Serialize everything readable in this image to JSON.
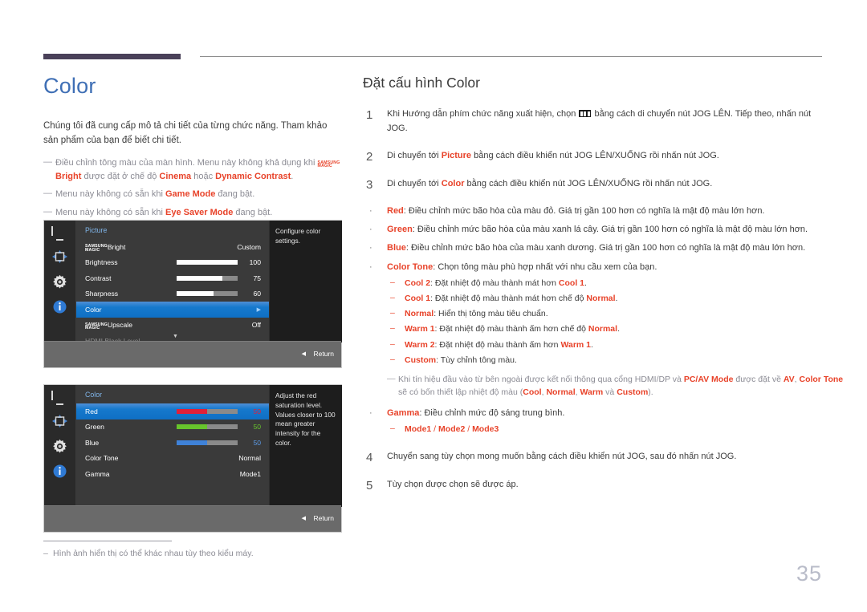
{
  "page_title": "Color",
  "page_number": "35",
  "left": {
    "intro": "Chúng tôi đã cung cấp mô tả chi tiết của từng chức năng. Tham khảo sản phẩm của bạn để biết chi tiết.",
    "note1_a": "Điều chỉnh tông màu của màn hình. Menu này không khả dụng khi ",
    "note1_magic_line1": "SAMSUNG",
    "note1_magic_line2": "MAGIC",
    "note1_b": "Bright",
    "note1_c": " được đặt ở chế độ ",
    "note1_d": "Cinema",
    "note1_e": " hoặc ",
    "note1_f": "Dynamic Contrast",
    "note1_g": ".",
    "note2_a": "Menu này không có sẵn khi ",
    "note2_b": "Game Mode",
    "note2_c": " đang bật.",
    "note3_a": "Menu này không có sẵn khi ",
    "note3_b": "Eye Saver Mode",
    "note3_c": " đang bật."
  },
  "footnote": {
    "text": "Hình ảnh hiển thị có thể khác nhau tùy theo kiểu máy."
  },
  "osd_picture": {
    "title": "Picture",
    "description": "Configure color settings.",
    "return_label": "Return",
    "rows": [
      {
        "label_magic1": "SAMSUNG",
        "label_magic2": "MAGIC",
        "label": "Bright",
        "value": "Custom",
        "slider": null,
        "state": "normal"
      },
      {
        "label": "Brightness",
        "value": "100",
        "slider": 100,
        "state": "normal"
      },
      {
        "label": "Contrast",
        "value": "75",
        "slider": 75,
        "state": "normal"
      },
      {
        "label": "Sharpness",
        "value": "60",
        "slider": 60,
        "state": "normal"
      },
      {
        "label": "Color",
        "value": "",
        "slider": null,
        "state": "selected"
      },
      {
        "label_magic1": "SAMSUNG",
        "label_magic2": "MAGIC",
        "label": "Upscale",
        "value": "Off",
        "slider": null,
        "state": "normal"
      },
      {
        "label": "HDMI Black Level",
        "value": "",
        "slider": null,
        "state": "dim"
      }
    ]
  },
  "osd_color": {
    "title": "Color",
    "description": "Adjust the red saturation level. Values closer to 100 mean greater intensity for the color.",
    "return_label": "Return",
    "rows": [
      {
        "label": "Red",
        "value": "50",
        "slider": 50,
        "state": "selected",
        "color": "#e0203a"
      },
      {
        "label": "Green",
        "value": "50",
        "slider": 50,
        "state": "normal",
        "color": "#67c42c"
      },
      {
        "label": "Blue",
        "value": "50",
        "slider": 50,
        "state": "normal",
        "color": "#3f82d8"
      },
      {
        "label": "Color Tone",
        "value": "Normal",
        "slider": null,
        "state": "normal"
      },
      {
        "label": "Gamma",
        "value": "Mode1",
        "slider": null,
        "state": "normal"
      }
    ]
  },
  "right": {
    "title": "Đặt cấu hình Color",
    "step1_num": "1",
    "step1_a": "Khi Hướng dẫn phím chức năng xuất hiện, chọn ",
    "step1_b": " bằng cách di chuyển nút JOG LÊN. Tiếp theo, nhấn nút JOG.",
    "step2_num": "2",
    "step2_a": "Di chuyển tới ",
    "step2_b": "Picture",
    "step2_c": " bằng cách điều khiển nút JOG LÊN/XUỐNG rồi nhấn nút JOG.",
    "step3_num": "3",
    "step3_a": "Di chuyển tới ",
    "step3_b": "Color",
    "step3_c": " bằng cách điều khiển nút JOG LÊN/XUỐNG rồi nhấn nút JOG.",
    "b_red_label": "Red",
    "b_red_text": ": Điều chỉnh mức bão hòa của màu đỏ. Giá trị gần 100 hơn có nghĩa là mật độ màu lớn hơn.",
    "b_green_label": "Green",
    "b_green_text": ": Điều chỉnh mức bão hòa của màu xanh lá cây. Giá trị gần 100 hơn có nghĩa là mật độ màu lớn hơn.",
    "b_blue_label": "Blue",
    "b_blue_text": ": Điều chỉnh mức bão hòa của màu xanh dương. Giá trị gần 100 hơn có nghĩa là mật độ màu lớn hơn.",
    "b_tone_label": "Color Tone",
    "b_tone_text": ": Chọn tông màu phù hợp nhất với nhu cầu xem của bạn.",
    "sub_cool2_label": "Cool 2",
    "sub_cool2_a": ": Đặt nhiệt độ màu thành mát hơn ",
    "sub_cool2_b": "Cool 1",
    "sub_cool2_c": ".",
    "sub_cool1_label": "Cool 1",
    "sub_cool1_a": ": Đặt nhiệt độ màu thành mát hơn chế độ ",
    "sub_cool1_b": "Normal",
    "sub_cool1_c": ".",
    "sub_normal_label": "Normal",
    "sub_normal_a": ": Hiển thị tông màu tiêu chuẩn.",
    "sub_warm1_label": "Warm 1",
    "sub_warm1_a": ": Đặt nhiệt độ màu thành ấm hơn chế độ ",
    "sub_warm1_b": "Normal",
    "sub_warm1_c": ".",
    "sub_warm2_label": "Warm 2",
    "sub_warm2_a": ": Đặt nhiệt độ màu thành ấm hơn ",
    "sub_warm2_b": "Warm 1",
    "sub_warm2_c": ".",
    "sub_custom_label": "Custom",
    "sub_custom_a": ": Tùy chỉnh tông màu.",
    "note_a": "Khi tín hiệu đầu vào từ bên ngoài được kết nối thông qua cổng HDMI/DP và ",
    "note_b": "PC/AV Mode",
    "note_c": " được đặt về ",
    "note_d": "AV",
    "note_e": ", ",
    "note_f": "Color Tone",
    "note_g": " sẽ có bốn thiết lập nhiệt độ màu (",
    "note_h": "Cool",
    "note_i": ", ",
    "note_j": "Normal",
    "note_k": ", ",
    "note_l": "Warm",
    "note_m": " và ",
    "note_n": "Custom",
    "note_o": ").",
    "b_gamma_label": "Gamma",
    "b_gamma_text": ": Điều chỉnh mức độ sáng trung bình.",
    "sub_mode1": "Mode1",
    "sub_sep1": " / ",
    "sub_mode2": "Mode2",
    "sub_sep2": " / ",
    "sub_mode3": "Mode3",
    "step4_num": "4",
    "step4_a": "Chuyển sang tùy chọn mong muốn bằng cách điều khiển nút JOG, sau đó nhấn nút JOG.",
    "step5_num": "5",
    "step5_a": "Tùy chọn được chọn sẽ được áp."
  },
  "colors": {
    "accent_red": "#e8432a",
    "title_blue": "#3f6fb5",
    "header_bar": "#4a4159"
  }
}
